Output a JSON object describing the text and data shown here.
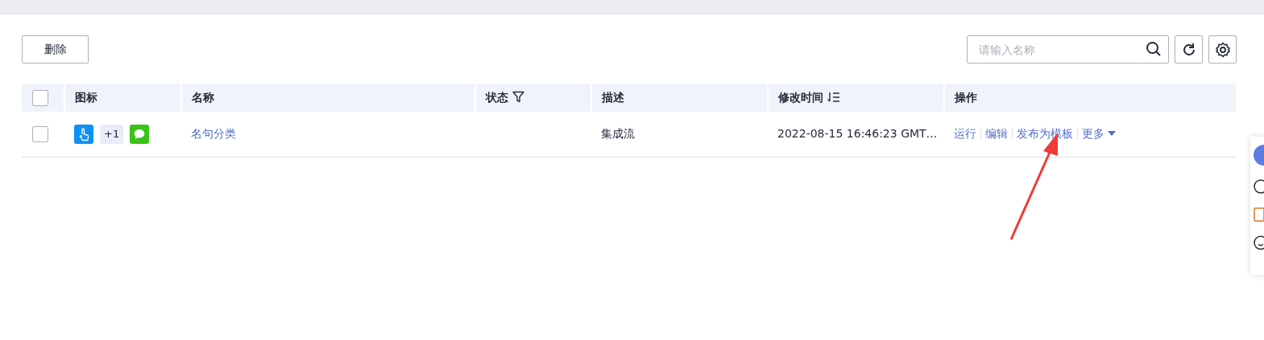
{
  "toolbar": {
    "delete_button": "删除",
    "search": {
      "placeholder": "请输入名称"
    }
  },
  "table": {
    "select_all": {
      "checked": false
    },
    "columns": [
      {
        "label": "图标",
        "kind": "plain"
      },
      {
        "label": "名称",
        "kind": "plain"
      },
      {
        "label": "状态",
        "kind": "filter"
      },
      {
        "label": "描述",
        "kind": "plain"
      },
      {
        "label": "修改时间",
        "kind": "sort"
      },
      {
        "label": "操作",
        "kind": "plain"
      }
    ],
    "rows": [
      {
        "checked": false,
        "icon_count": "+1",
        "name": "名句分类",
        "description": "集成流",
        "modified": "2022-08-15 16:46:23 GMT…",
        "actions": [
          {
            "label": "运行",
            "kind": "link"
          },
          {
            "label": "编辑",
            "kind": "link"
          },
          {
            "label": "发布为模板",
            "kind": "link"
          },
          {
            "label": "更多",
            "kind": "dropdown"
          }
        ]
      }
    ]
  }
}
